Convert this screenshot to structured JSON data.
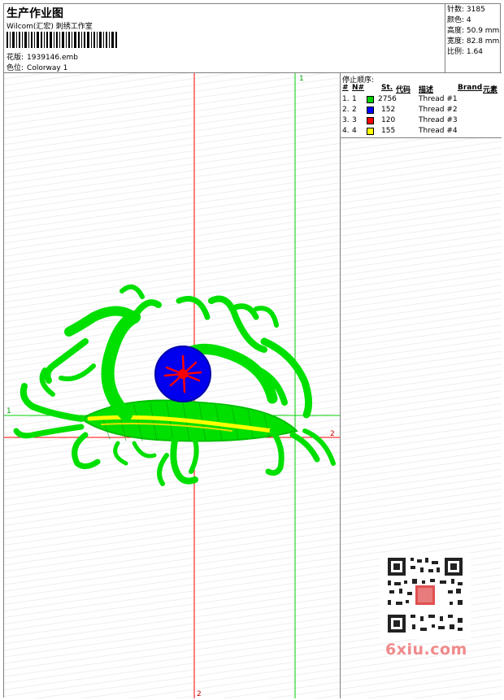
{
  "header": {
    "title": "生产作业图",
    "subtitle": "Wilcom(汇宏) 刺绣工作室",
    "design_label": "花版:",
    "design_value": "1939146.emb",
    "colorway_label": "色位:",
    "colorway_value": "Colorway 1"
  },
  "stats": {
    "stitches": "针数: 3185",
    "colors": "颜色: 4",
    "height": "高度: 50.9 mm",
    "width": "宽度: 82.8 mm",
    "ratio": "比例: 1.64"
  },
  "threads": {
    "caption": "停止顺序:",
    "headers": {
      "num": "#",
      "n": "N#",
      "st": "St.",
      "code": "代码",
      "desc": "描述",
      "brand": "Brand",
      "elem": "元素"
    },
    "rows": [
      {
        "num": "1.",
        "n": "1",
        "st": "2756",
        "color": "#00d000",
        "desc": "Thread #1"
      },
      {
        "num": "2.",
        "n": "2",
        "st": "152",
        "color": "#0000ff",
        "desc": "Thread #2"
      },
      {
        "num": "3.",
        "n": "3",
        "st": "120",
        "color": "#ff0000",
        "desc": "Thread #3"
      },
      {
        "num": "4.",
        "n": "4",
        "st": "155",
        "color": "#ffff00",
        "desc": "Thread #4"
      }
    ]
  },
  "guides": {
    "green_v_label": "1",
    "green_h_label": "1",
    "red_h_label": "2",
    "red_v_label": "2"
  },
  "colors": {
    "green": "#00e000",
    "red": "#ff0000",
    "blue": "#0000ff",
    "yellow": "#ffff00"
  },
  "watermark": "6xiu.com"
}
